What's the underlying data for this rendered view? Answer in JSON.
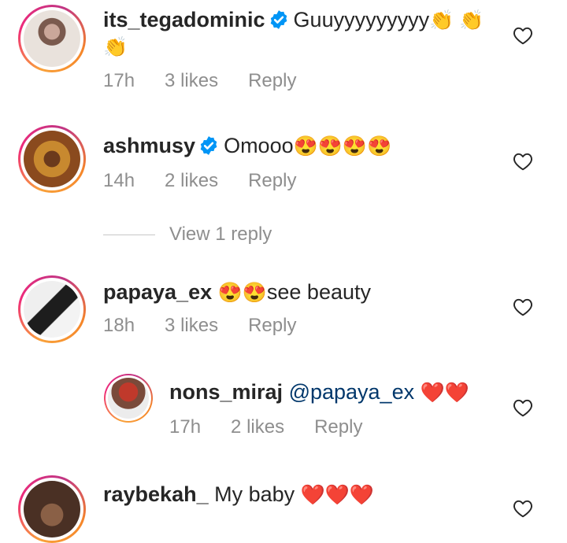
{
  "comments": [
    {
      "username": "its_tegadominic",
      "verified": true,
      "text": "Guuyyyyyyyyy",
      "emoji_trail": "👏 👏",
      "continuation": "👏",
      "time": "17h",
      "likes": "3 likes",
      "reply": "Reply",
      "avatar_color": "#8a6f63"
    },
    {
      "username": "ashmusy",
      "verified": true,
      "text": "Omooo",
      "emoji_trail": "😍😍😍😍",
      "time": "14h",
      "likes": "2 likes",
      "reply": "Reply",
      "view_replies": "View 1 reply",
      "avatar_color": "#9a5a2c"
    },
    {
      "username": "papaya_ex",
      "verified": false,
      "emoji_lead": "😍😍",
      "text": "see beauty",
      "time": "18h",
      "likes": "3 likes",
      "reply": "Reply",
      "avatar_color": "#d8d8d8"
    },
    {
      "username": "nons_miraj",
      "verified": false,
      "mention": "@papaya_ex",
      "emoji_trail": "❤️❤️",
      "time": "17h",
      "likes": "2 likes",
      "reply": "Reply",
      "avatar_color": "#b33a3a"
    },
    {
      "username": "raybekah_",
      "verified": false,
      "text": "My baby",
      "emoji_trail": "❤️❤️❤️",
      "avatar_color": "#6b4a35"
    }
  ],
  "colors": {
    "text": "#262626",
    "meta": "#8e8e8e",
    "verified_blue": "#0095f6",
    "mention": "#00376b"
  },
  "icons": {
    "like": "heart-outline-icon",
    "verified": "verified-badge-icon"
  }
}
